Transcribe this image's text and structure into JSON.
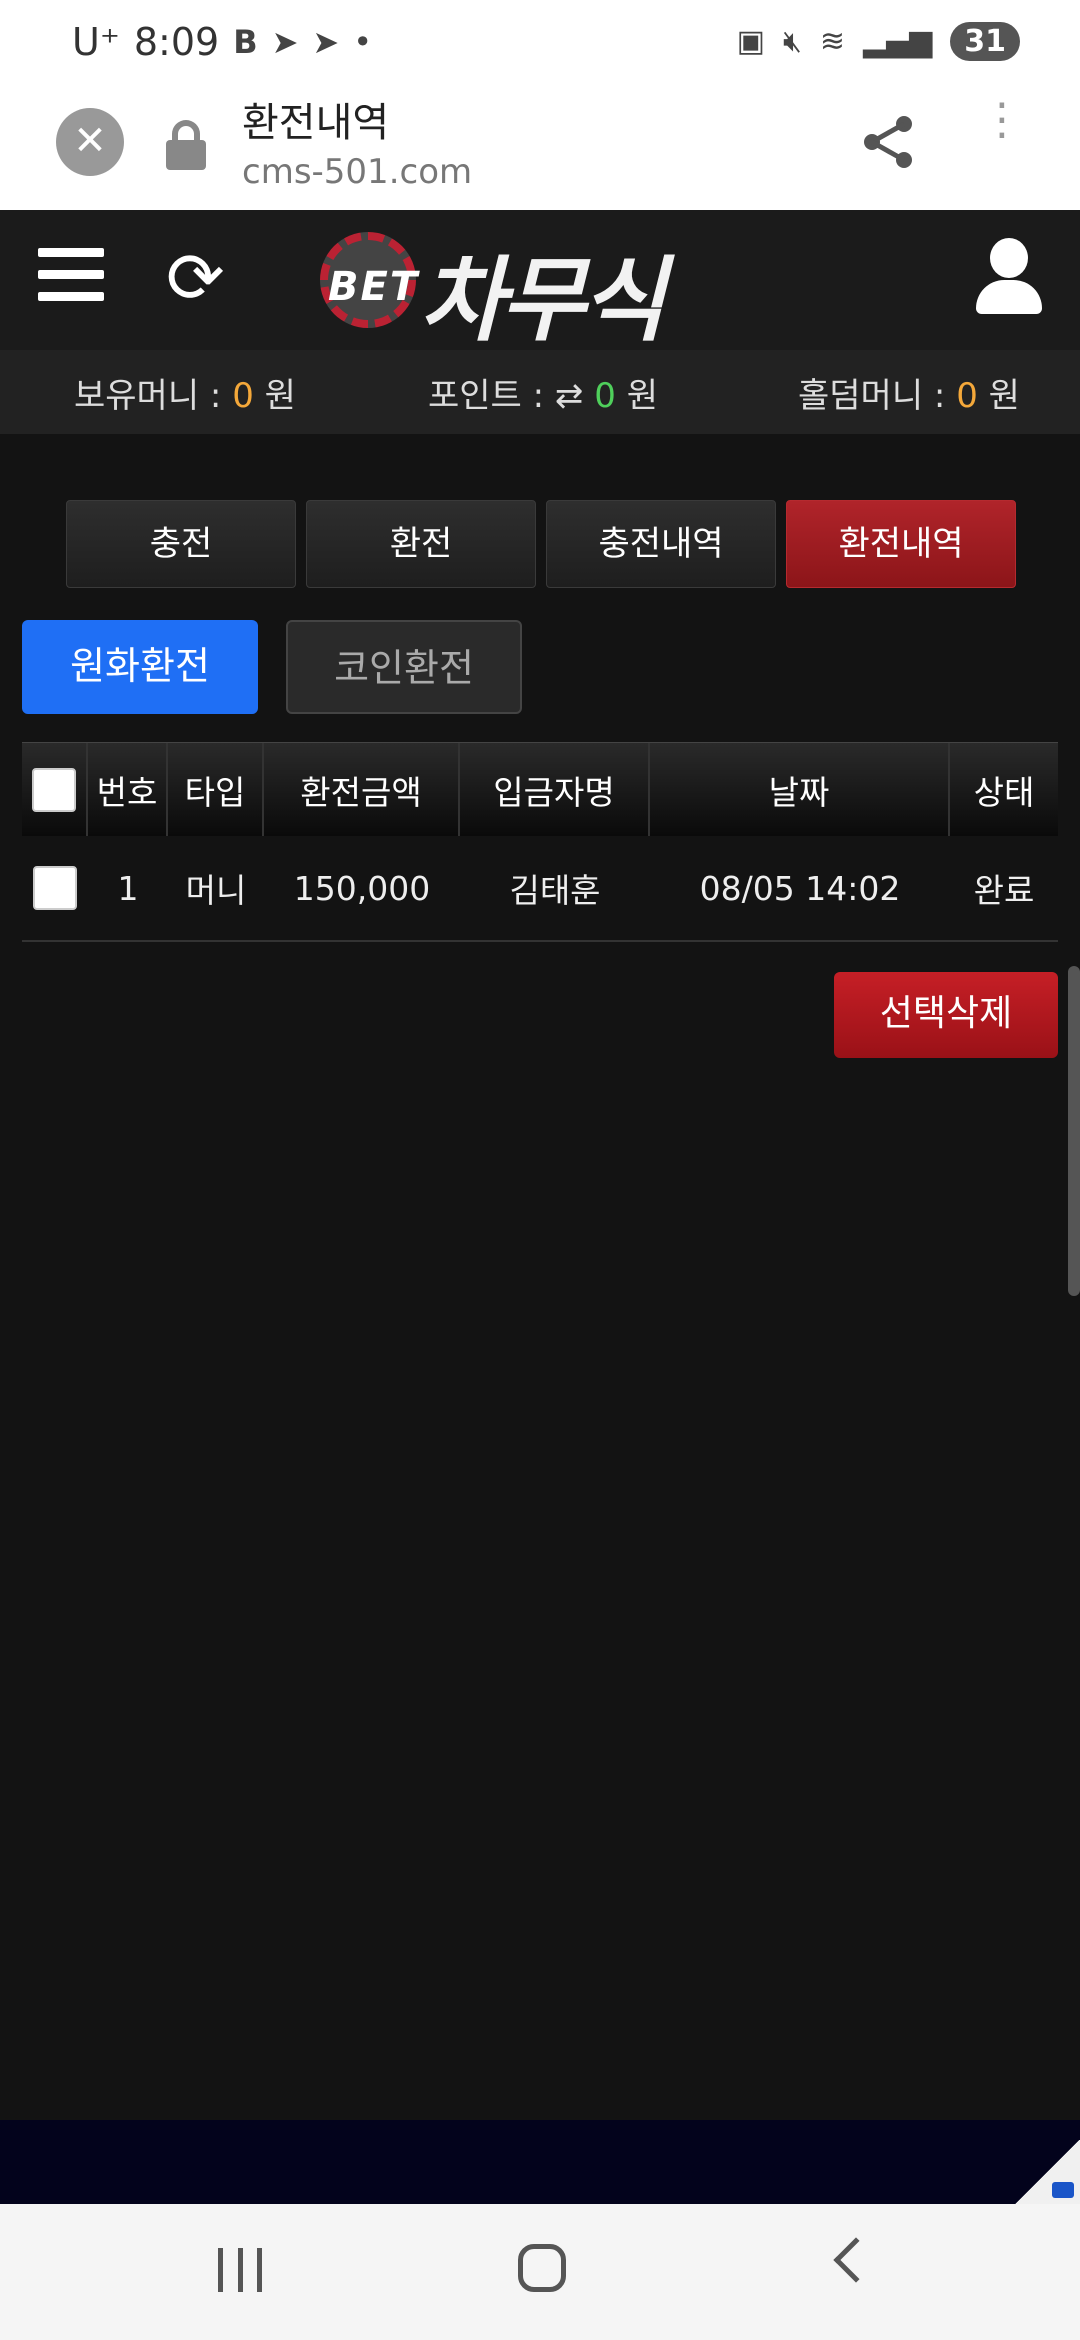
{
  "status_bar": {
    "carrier": "U⁺",
    "time": "8:09",
    "battery": "31"
  },
  "browser": {
    "title": "환전내역",
    "url": "cms-501.com",
    "close_symbol": "✕",
    "menu_symbol": "⋮"
  },
  "header": {
    "logo_prefix": "BET",
    "logo_brand": "차무식",
    "refresh_symbol": "⟳"
  },
  "balances": {
    "money_label": "보유머니 :",
    "money_value": "0",
    "money_unit": "원",
    "point_label": "포인트 :",
    "point_value": "0",
    "point_unit": "원",
    "point_symbol": "⇄",
    "holdem_label": "홀덤머니 :",
    "holdem_value": "0",
    "holdem_unit": "원"
  },
  "tabs": [
    {
      "label": "충전"
    },
    {
      "label": "환전"
    },
    {
      "label": "충전내역"
    },
    {
      "label": "환전내역"
    }
  ],
  "subtabs": [
    {
      "label": "원화환전"
    },
    {
      "label": "코인환전"
    }
  ],
  "table": {
    "headers": [
      "번호",
      "타입",
      "환전금액",
      "입금자명",
      "날짜",
      "상태"
    ],
    "rows": [
      {
        "no": "1",
        "type": "머니",
        "amount": "150,000",
        "depositor": "김태훈",
        "date": "08/05 14:02",
        "status": "완료"
      }
    ]
  },
  "actions": {
    "delete_selected": "선택삭제"
  },
  "colors": {
    "active_tab": "#b0242a",
    "active_subtab": "#1f6ff5",
    "accent_orange": "#f4a83a",
    "accent_green": "#4fcf5b"
  }
}
